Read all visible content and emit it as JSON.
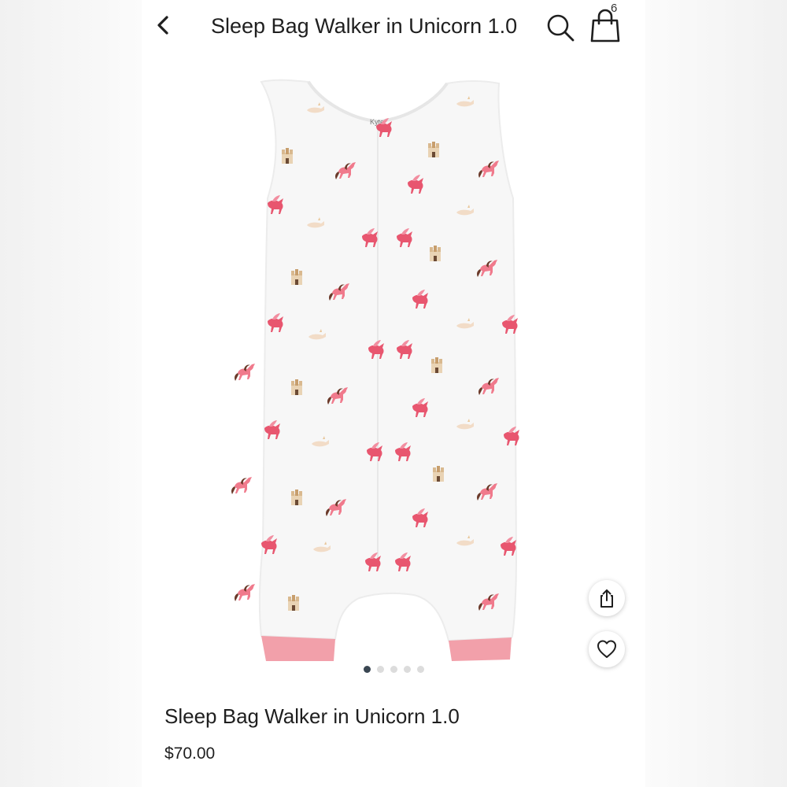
{
  "header": {
    "title": "Sleep Bag Walker in Unicorn 1.0",
    "back_icon": "chevron-left-icon",
    "search_icon": "search-icon",
    "bag_icon": "shopping-bag-icon",
    "bag_count": "6"
  },
  "product": {
    "image_label": "Kyte",
    "title": "Sleep Bag Walker in Unicorn 1.0",
    "price": "$70.00",
    "garment_color": "#f7f7f7",
    "accent_color": "#f2a0aa",
    "print_color": "#e8566f"
  },
  "carousel": {
    "total": 5,
    "active_index": 0
  },
  "actions": {
    "share_icon": "share-icon",
    "like_icon": "heart-icon"
  }
}
